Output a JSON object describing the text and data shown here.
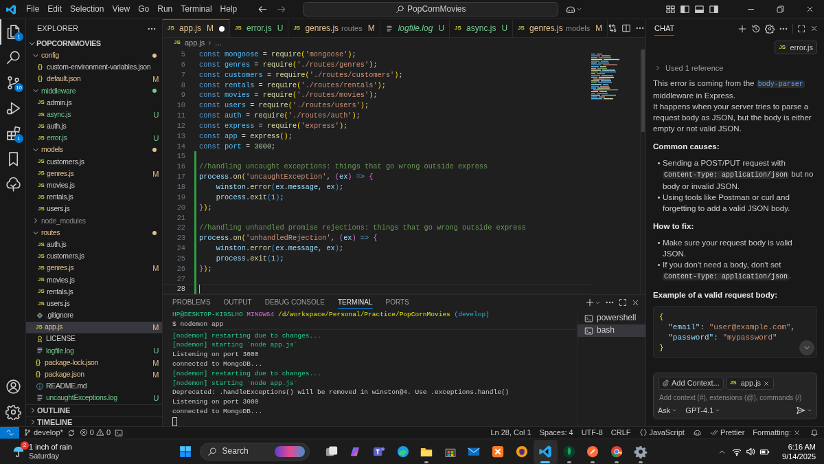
{
  "title_bar": {
    "menu": [
      "File",
      "Edit",
      "Selection",
      "View",
      "Go",
      "Run",
      "Terminal",
      "Help"
    ],
    "search": "PopCornMovies"
  },
  "activity_bar": {
    "top": [
      {
        "kind": "explorer",
        "selected": true,
        "badge": "1"
      },
      {
        "kind": "search",
        "selected": false
      },
      {
        "kind": "source_control",
        "selected": false,
        "badge": "10"
      },
      {
        "kind": "run_debug",
        "selected": false
      },
      {
        "kind": "extensions",
        "selected": false,
        "badge": "1"
      },
      {
        "kind": "bookmarks",
        "selected": false
      },
      {
        "kind": "tree",
        "selected": false
      }
    ],
    "bottom": [
      {
        "kind": "account"
      },
      {
        "kind": "settings"
      }
    ]
  },
  "explorer": {
    "title": "EXPLORER",
    "root": {
      "label": "POPCORNMOVIES",
      "expanded": true
    },
    "tree": [
      {
        "kind": "folder",
        "label": "config",
        "expanded": true,
        "ignored": false,
        "color": "#e2c08d",
        "children": [
          {
            "kind": "json",
            "glyph": "{}",
            "label": "custom-environment-variables.json",
            "selected": false
          },
          {
            "kind": "json",
            "glyph": "{}",
            "label": "default.json",
            "status": "M",
            "selected": false
          }
        ]
      },
      {
        "kind": "folder",
        "label": "middleware",
        "expanded": true,
        "ignored": false,
        "color": "#73c991",
        "children": [
          {
            "kind": "js",
            "glyph": "JS",
            "label": "admin.js",
            "selected": false
          },
          {
            "kind": "js",
            "glyph": "JS",
            "label": "async.js",
            "status": "U",
            "selected": false
          },
          {
            "kind": "js",
            "glyph": "JS",
            "label": "auth.js",
            "selected": false
          },
          {
            "kind": "js",
            "glyph": "JS",
            "label": "error.js",
            "status": "U",
            "selected": false
          }
        ]
      },
      {
        "kind": "folder",
        "label": "models",
        "expanded": true,
        "ignored": false,
        "color": "#e2c08d",
        "children": [
          {
            "kind": "js",
            "glyph": "JS",
            "label": "customers.js",
            "selected": false
          },
          {
            "kind": "js",
            "glyph": "JS",
            "label": "genres.js",
            "status": "M",
            "selected": false
          },
          {
            "kind": "js",
            "glyph": "JS",
            "label": "movies.js",
            "selected": false
          },
          {
            "kind": "js",
            "glyph": "JS",
            "label": "rentals.js",
            "selected": false
          },
          {
            "kind": "js",
            "glyph": "JS",
            "label": "users.js",
            "selected": false
          }
        ]
      },
      {
        "kind": "folder",
        "label": "node_modules",
        "expanded": false,
        "ignored": true
      },
      {
        "kind": "folder",
        "label": "routes",
        "expanded": true,
        "ignored": false,
        "color": "#e2c08d",
        "children": [
          {
            "kind": "js",
            "glyph": "JS",
            "label": "auth.js",
            "selected": false
          },
          {
            "kind": "js",
            "glyph": "JS",
            "label": "customers.js",
            "selected": false
          },
          {
            "kind": "js",
            "glyph": "JS",
            "label": "genres.js",
            "status": "M",
            "selected": false
          },
          {
            "kind": "js",
            "glyph": "JS",
            "label": "movies.js",
            "selected": false
          },
          {
            "kind": "js",
            "glyph": "JS",
            "label": "rentals.js",
            "selected": false
          },
          {
            "kind": "js",
            "glyph": "JS",
            "label": "users.js",
            "selected": false
          }
        ]
      },
      {
        "kind": "git",
        "label": ".gitignore",
        "selected": false
      },
      {
        "kind": "js",
        "glyph": "JS",
        "label": "app.js",
        "status": "M",
        "selected": true
      },
      {
        "kind": "license",
        "label": "LICENSE",
        "selected": false
      },
      {
        "kind": "log",
        "label": "logfile.log",
        "status": "U",
        "selected": false
      },
      {
        "kind": "json",
        "glyph": "{}",
        "label": "package-lock.json",
        "status": "M",
        "selected": false
      },
      {
        "kind": "json",
        "glyph": "{}",
        "label": "package.json",
        "status": "M",
        "selected": false
      },
      {
        "kind": "info",
        "label": "README.md",
        "selected": false
      },
      {
        "kind": "log",
        "label": "uncaughtExceptions.log",
        "status": "U",
        "selected": false
      }
    ],
    "sections": [
      {
        "label": "OUTLINE",
        "expanded": false
      },
      {
        "label": "TIMELINE",
        "expanded": false
      }
    ]
  },
  "editor": {
    "tabs": [
      {
        "kind": "js",
        "glyph": "JS",
        "label": "app.js",
        "status": "M",
        "dirty": true,
        "preview": false,
        "selected": true
      },
      {
        "kind": "js",
        "glyph": "JS",
        "label": "error.js",
        "status": "U",
        "dirty": false,
        "preview": false,
        "selected": false
      },
      {
        "kind": "js",
        "glyph": "JS",
        "label": "genres.js",
        "description": "routes",
        "status": "M",
        "dirty": false,
        "preview": false,
        "selected": false
      },
      {
        "kind": "log",
        "label": "logfile.log",
        "status": "U",
        "dirty": false,
        "preview": true,
        "selected": false
      },
      {
        "kind": "js",
        "glyph": "JS",
        "label": "async.js",
        "status": "U",
        "dirty": false,
        "preview": false,
        "selected": false
      },
      {
        "kind": "js",
        "glyph": "JS",
        "label": "genres.js",
        "description": "models",
        "status": "M",
        "dirty": false,
        "preview": false,
        "selected": false
      }
    ],
    "breadcrumb": {
      "glyph": "JS",
      "file": "app.js",
      "rest": "..."
    },
    "lines": [
      {
        "number": "5",
        "added": false,
        "current": false,
        "tokens": [
          {
            "kind": "k",
            "text": "const "
          },
          {
            "kind": "v",
            "text": "mongoose"
          },
          {
            "kind": "p",
            "text": " = "
          },
          {
            "kind": "f",
            "text": "require"
          },
          {
            "kind": "y",
            "text": "("
          },
          {
            "kind": "s",
            "text": "'mongoose'"
          },
          {
            "kind": "y",
            "text": ")"
          },
          {
            "kind": "p",
            "text": ";"
          }
        ]
      },
      {
        "number": "6",
        "added": false,
        "current": false,
        "tokens": [
          {
            "kind": "k",
            "text": "const "
          },
          {
            "kind": "v",
            "text": "genres"
          },
          {
            "kind": "p",
            "text": " = "
          },
          {
            "kind": "f",
            "text": "require"
          },
          {
            "kind": "y",
            "text": "("
          },
          {
            "kind": "s",
            "text": "'./routes/genres'"
          },
          {
            "kind": "y",
            "text": ")"
          },
          {
            "kind": "p",
            "text": ";"
          }
        ]
      },
      {
        "number": "7",
        "added": false,
        "current": false,
        "tokens": [
          {
            "kind": "k",
            "text": "const "
          },
          {
            "kind": "v",
            "text": "customers"
          },
          {
            "kind": "p",
            "text": " = "
          },
          {
            "kind": "f",
            "text": "require"
          },
          {
            "kind": "y",
            "text": "("
          },
          {
            "kind": "s",
            "text": "'./routes/customers'"
          },
          {
            "kind": "y",
            "text": ")"
          },
          {
            "kind": "p",
            "text": ";"
          }
        ]
      },
      {
        "number": "8",
        "added": false,
        "current": false,
        "tokens": [
          {
            "kind": "k",
            "text": "const "
          },
          {
            "kind": "v",
            "text": "rentals"
          },
          {
            "kind": "p",
            "text": " = "
          },
          {
            "kind": "f",
            "text": "require"
          },
          {
            "kind": "y",
            "text": "("
          },
          {
            "kind": "s",
            "text": "'./routes/rentals'"
          },
          {
            "kind": "y",
            "text": ")"
          },
          {
            "kind": "p",
            "text": ";"
          }
        ]
      },
      {
        "number": "9",
        "added": false,
        "current": false,
        "tokens": [
          {
            "kind": "k",
            "text": "const "
          },
          {
            "kind": "v",
            "text": "movies"
          },
          {
            "kind": "p",
            "text": " = "
          },
          {
            "kind": "f",
            "text": "require"
          },
          {
            "kind": "y",
            "text": "("
          },
          {
            "kind": "s",
            "text": "'./routes/movies'"
          },
          {
            "kind": "y",
            "text": ")"
          },
          {
            "kind": "p",
            "text": ";"
          }
        ]
      },
      {
        "number": "10",
        "added": false,
        "current": false,
        "tokens": [
          {
            "kind": "k",
            "text": "const "
          },
          {
            "kind": "v",
            "text": "users"
          },
          {
            "kind": "p",
            "text": " = "
          },
          {
            "kind": "f",
            "text": "require"
          },
          {
            "kind": "y",
            "text": "("
          },
          {
            "kind": "s",
            "text": "'./routes/users'"
          },
          {
            "kind": "y",
            "text": ")"
          },
          {
            "kind": "p",
            "text": ";"
          }
        ]
      },
      {
        "number": "11",
        "added": false,
        "current": false,
        "tokens": [
          {
            "kind": "k",
            "text": "const "
          },
          {
            "kind": "v",
            "text": "auth"
          },
          {
            "kind": "p",
            "text": " = "
          },
          {
            "kind": "f",
            "text": "require"
          },
          {
            "kind": "y",
            "text": "("
          },
          {
            "kind": "s",
            "text": "'./routes/auth'"
          },
          {
            "kind": "y",
            "text": ")"
          },
          {
            "kind": "p",
            "text": ";"
          }
        ]
      },
      {
        "number": "12",
        "added": false,
        "current": false,
        "tokens": [
          {
            "kind": "k",
            "text": "const "
          },
          {
            "kind": "v",
            "text": "express"
          },
          {
            "kind": "p",
            "text": " = "
          },
          {
            "kind": "f",
            "text": "require"
          },
          {
            "kind": "y",
            "text": "("
          },
          {
            "kind": "s",
            "text": "'express'"
          },
          {
            "kind": "y",
            "text": ")"
          },
          {
            "kind": "p",
            "text": ";"
          }
        ]
      },
      {
        "number": "13",
        "added": false,
        "current": false,
        "tokens": [
          {
            "kind": "k",
            "text": "const "
          },
          {
            "kind": "v",
            "text": "app"
          },
          {
            "kind": "p",
            "text": " = "
          },
          {
            "kind": "f",
            "text": "express"
          },
          {
            "kind": "y",
            "text": "()"
          },
          {
            "kind": "p",
            "text": ";"
          }
        ]
      },
      {
        "number": "14",
        "added": false,
        "current": false,
        "tokens": [
          {
            "kind": "k",
            "text": "const "
          },
          {
            "kind": "v",
            "text": "port"
          },
          {
            "kind": "p",
            "text": " = "
          },
          {
            "kind": "n",
            "text": "3000"
          },
          {
            "kind": "p",
            "text": ";"
          }
        ]
      },
      {
        "number": "15",
        "added": true,
        "current": false
      },
      {
        "number": "16",
        "added": true,
        "current": false,
        "tokens": [
          {
            "kind": "c",
            "text": "//handling uncaught exceptions: things that go wrong outside express"
          }
        ]
      },
      {
        "number": "17",
        "added": true,
        "current": false,
        "tokens": [
          {
            "kind": "i",
            "text": "process"
          },
          {
            "kind": "p",
            "text": "."
          },
          {
            "kind": "f",
            "text": "on"
          },
          {
            "kind": "y",
            "text": "("
          },
          {
            "kind": "s",
            "text": "'uncaughtException'"
          },
          {
            "kind": "p",
            "text": ", "
          },
          {
            "kind": "m",
            "text": "("
          },
          {
            "kind": "i",
            "text": "ex"
          },
          {
            "kind": "m",
            "text": ")"
          },
          {
            "kind": "k",
            "text": " => "
          },
          {
            "kind": "m",
            "text": "{"
          }
        ]
      },
      {
        "number": "18",
        "added": true,
        "current": false,
        "tokens": [
          {
            "kind": "i",
            "text": "    winston"
          },
          {
            "kind": "p",
            "text": "."
          },
          {
            "kind": "f",
            "text": "error"
          },
          {
            "kind": "b",
            "text": "("
          },
          {
            "kind": "i",
            "text": "ex"
          },
          {
            "kind": "p",
            "text": "."
          },
          {
            "kind": "i",
            "text": "message"
          },
          {
            "kind": "p",
            "text": ", "
          },
          {
            "kind": "i",
            "text": "ex"
          },
          {
            "kind": "b",
            "text": ")"
          },
          {
            "kind": "p",
            "text": ";"
          }
        ]
      },
      {
        "number": "19",
        "added": true,
        "current": false,
        "tokens": [
          {
            "kind": "i",
            "text": "    process"
          },
          {
            "kind": "p",
            "text": "."
          },
          {
            "kind": "f",
            "text": "exit"
          },
          {
            "kind": "b",
            "text": "("
          },
          {
            "kind": "n",
            "text": "1"
          },
          {
            "kind": "b",
            "text": ")"
          },
          {
            "kind": "p",
            "text": ";"
          }
        ]
      },
      {
        "number": "20",
        "added": true,
        "current": false,
        "tokens": [
          {
            "kind": "m",
            "text": "}"
          },
          {
            "kind": "y",
            "text": ")"
          },
          {
            "kind": "p",
            "text": ";"
          }
        ]
      },
      {
        "number": "21",
        "added": true,
        "current": false
      },
      {
        "number": "22",
        "added": true,
        "current": false,
        "tokens": [
          {
            "kind": "c",
            "text": "//handling unhandled promise rejections: things that go wrong outside express"
          }
        ]
      },
      {
        "number": "23",
        "added": true,
        "current": false,
        "tokens": [
          {
            "kind": "i",
            "text": "process"
          },
          {
            "kind": "p",
            "text": "."
          },
          {
            "kind": "f",
            "text": "on"
          },
          {
            "kind": "y",
            "text": "("
          },
          {
            "kind": "s",
            "text": "'unhandledRejection'"
          },
          {
            "kind": "p",
            "text": ", "
          },
          {
            "kind": "m",
            "text": "("
          },
          {
            "kind": "i",
            "text": "ex"
          },
          {
            "kind": "m",
            "text": ")"
          },
          {
            "kind": "k",
            "text": " => "
          },
          {
            "kind": "m",
            "text": "{"
          }
        ]
      },
      {
        "number": "24",
        "added": true,
        "current": false,
        "tokens": [
          {
            "kind": "i",
            "text": "    winston"
          },
          {
            "kind": "p",
            "text": "."
          },
          {
            "kind": "f",
            "text": "error"
          },
          {
            "kind": "b",
            "text": "("
          },
          {
            "kind": "i",
            "text": "ex"
          },
          {
            "kind": "p",
            "text": "."
          },
          {
            "kind": "i",
            "text": "message"
          },
          {
            "kind": "p",
            "text": ", "
          },
          {
            "kind": "i",
            "text": "ex"
          },
          {
            "kind": "b",
            "text": ")"
          },
          {
            "kind": "p",
            "text": ";"
          }
        ]
      },
      {
        "number": "25",
        "added": true,
        "current": false,
        "tokens": [
          {
            "kind": "i",
            "text": "    process"
          },
          {
            "kind": "p",
            "text": "."
          },
          {
            "kind": "f",
            "text": "exit"
          },
          {
            "kind": "b",
            "text": "("
          },
          {
            "kind": "n",
            "text": "1"
          },
          {
            "kind": "b",
            "text": ")"
          },
          {
            "kind": "p",
            "text": ";"
          }
        ]
      },
      {
        "number": "26",
        "added": true,
        "current": false,
        "tokens": [
          {
            "kind": "m",
            "text": "}"
          },
          {
            "kind": "y",
            "text": ")"
          },
          {
            "kind": "p",
            "text": ";"
          }
        ]
      },
      {
        "number": "27",
        "added": true,
        "current": false
      },
      {
        "number": "28",
        "added": true,
        "current": true
      }
    ]
  },
  "panel": {
    "tabs": [
      {
        "label": "PROBLEMS",
        "selected": false
      },
      {
        "label": "OUTPUT",
        "selected": false
      },
      {
        "label": "DEBUG CONSOLE",
        "selected": false
      },
      {
        "label": "TERMINAL",
        "selected": true
      },
      {
        "label": "PORTS",
        "selected": false
      }
    ],
    "terminal": {
      "cursor": true,
      "sticky_lines": [
        [
          {
            "kind": "g",
            "text": "HP@DESKTOP-KI9SLHO "
          },
          {
            "kind": "m",
            "text": "MINGW64 "
          },
          {
            "kind": "y",
            "text": "/d/workspace/Personal/Practice/PopCornMovies "
          },
          {
            "kind": "c",
            "text": "(develop)"
          }
        ],
        [
          {
            "kind": "w",
            "text": "$ nodemon app"
          }
        ]
      ],
      "lines": [
        [
          {
            "kind": "g",
            "text": "[nodemon] restarting due to changes..."
          }
        ],
        [
          {
            "kind": "g",
            "text": "[nodemon] starting `node app.js`"
          }
        ],
        [
          {
            "kind": "w",
            "text": "Listening on port 3000"
          }
        ],
        [
          {
            "kind": "w",
            "text": "connected to MongoDB..."
          }
        ],
        [
          {
            "kind": "g",
            "text": "[nodemon] restarting due to changes..."
          }
        ],
        [
          {
            "kind": "g",
            "text": "[nodemon] starting `node app.js`"
          }
        ],
        [
          {
            "kind": "w",
            "text": "Deprecated: .handleExceptions() will be removed in winston@4. Use .exceptions.handle()"
          }
        ],
        [
          {
            "kind": "w",
            "text": "Listening on port 3000"
          }
        ],
        [
          {
            "kind": "w",
            "text": "connected to MongoDB..."
          }
        ]
      ]
    },
    "terminals": [
      {
        "label": "powershell",
        "selected": false
      },
      {
        "label": "bash",
        "selected": true
      }
    ]
  },
  "chat": {
    "title": "CHAT",
    "attachment": {
      "glyph": "JS",
      "label": "error.js"
    },
    "references": {
      "label": "Used 1 reference",
      "expanded": false
    },
    "blocks": [
      {
        "kind": "paragraph",
        "segments": [
          {
            "text": "This error is coming from the "
          },
          {
            "text": "body-parser",
            "code": true
          },
          {
            "text": " middleware in Express."
          }
        ]
      },
      {
        "kind": "paragraph",
        "segments": [
          {
            "text": "It happens when your server tries to parse a request body as JSON, but the body is either empty or not valid JSON."
          }
        ]
      },
      {
        "kind": "heading",
        "text": "Common causes:"
      },
      {
        "kind": "list",
        "marker": "•",
        "items": [
          [
            {
              "text": "Sending a POST/PUT request with "
            },
            {
              "text": "Content-Type: application/json",
              "code": true
            },
            {
              "text": " but no body or invalid JSON."
            }
          ],
          [
            {
              "text": "Using tools like Postman or curl and forgetting to add a valid JSON body."
            }
          ]
        ]
      },
      {
        "kind": "heading",
        "text": "How to fix:"
      },
      {
        "kind": "list",
        "marker": "•",
        "items": [
          [
            {
              "text": "Make sure your request body is valid JSON."
            }
          ],
          [
            {
              "text": "If you don't need a body, don't set "
            },
            {
              "text": "Content-Type: application/json",
              "code": true
            },
            {
              "text": "."
            }
          ]
        ]
      },
      {
        "kind": "heading",
        "text": "Example of a valid request body:"
      },
      {
        "kind": "code",
        "lines": [
          {
            "tokens": [
              {
                "kind": "y",
                "text": "{"
              }
            ]
          },
          {
            "tokens": [
              {
                "kind": "i",
                "text": "  \"email\""
              },
              {
                "kind": "p",
                "text": ": "
              },
              {
                "kind": "s",
                "text": "\"user@example.com\""
              },
              {
                "kind": "p",
                "text": ","
              }
            ]
          },
          {
            "tokens": [
              {
                "kind": "i",
                "text": "  \"password\""
              },
              {
                "kind": "p",
                "text": ": "
              },
              {
                "kind": "s",
                "text": "\"mypassword\""
              }
            ]
          },
          {
            "tokens": [
              {
                "kind": "y",
                "text": "}"
              }
            ]
          }
        ]
      }
    ],
    "input": {
      "chips": [
        {
          "kind": "add_context",
          "label": "Add Context..."
        },
        {
          "kind": "file",
          "glyph": "JS",
          "label": "app.js"
        }
      ],
      "placeholder": "Add context (#), extensions (@), commands (/)",
      "mode": "Ask",
      "model": "GPT-4.1"
    }
  },
  "status_bar": {
    "branch": "develop*",
    "errors": "0",
    "warnings": "0",
    "right": [
      {
        "kind": "text",
        "text": "Ln 28, Col 1"
      },
      {
        "kind": "text",
        "text": "Spaces: 4"
      },
      {
        "kind": "text",
        "text": "UTF-8"
      },
      {
        "kind": "text",
        "text": "CRLF"
      },
      {
        "kind": "language",
        "text": "JavaScript"
      },
      {
        "kind": "copilot"
      },
      {
        "kind": "prettier",
        "text": "Prettier"
      },
      {
        "kind": "formatting",
        "text": "Formatting:"
      },
      {
        "kind": "bell"
      }
    ]
  },
  "taskbar": {
    "weather": {
      "badge": "2",
      "title": "1 inch of rain",
      "subtitle": "Saturday"
    },
    "search": "Search",
    "apps": [
      {
        "kind": "task_view",
        "running": false,
        "active": false
      },
      {
        "kind": "copilot",
        "running": false,
        "active": false
      },
      {
        "kind": "teams",
        "running": false,
        "active": false
      },
      {
        "kind": "edge",
        "running": false,
        "active": false
      },
      {
        "kind": "files",
        "running": true,
        "active": false
      },
      {
        "kind": "store",
        "running": false,
        "active": false
      },
      {
        "kind": "mail",
        "running": false,
        "active": false
      },
      {
        "kind": "xampp",
        "running": false,
        "active": false
      },
      {
        "kind": "vpn",
        "running": false,
        "active": false
      },
      {
        "kind": "vscode",
        "running": true,
        "active": true
      },
      {
        "kind": "mongodb",
        "running": true,
        "active": false
      },
      {
        "kind": "postman",
        "running": true,
        "active": false
      },
      {
        "kind": "chrome",
        "running": true,
        "active": false
      },
      {
        "kind": "gear",
        "running": true,
        "active": false
      }
    ],
    "clock": {
      "time": "6:16 AM",
      "date": "9/14/2025"
    }
  }
}
